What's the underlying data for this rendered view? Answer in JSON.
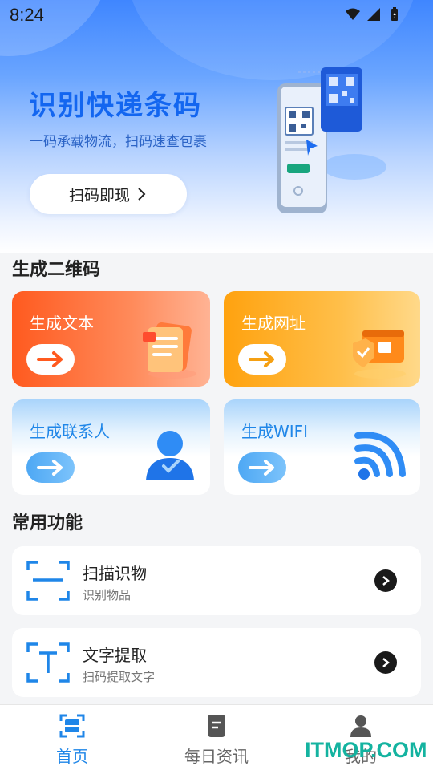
{
  "status_bar": {
    "time": "8:24"
  },
  "hero": {
    "title": "识别快递条码",
    "subtitle": "一码承载物流，扫码速查包裹",
    "scan_button": "扫码即现"
  },
  "generate_section": {
    "title": "生成二维码",
    "cards": [
      {
        "label": "生成文本",
        "icon": "document-icon"
      },
      {
        "label": "生成网址",
        "icon": "browser-icon"
      },
      {
        "label": "生成联系人",
        "icon": "person-icon"
      },
      {
        "label": "生成WIFI",
        "icon": "wifi-icon"
      }
    ]
  },
  "common_section": {
    "title": "常用功能",
    "items": [
      {
        "title": "扫描识物",
        "subtitle": "识别物品",
        "icon": "scan-frame-icon"
      },
      {
        "title": "文字提取",
        "subtitle": "扫码提取文字",
        "icon": "text-extract-icon"
      }
    ]
  },
  "bottom_nav": {
    "items": [
      {
        "label": "首页",
        "icon": "home-scan-icon",
        "active": true
      },
      {
        "label": "每日资讯",
        "icon": "news-icon",
        "active": false
      },
      {
        "label": "我的",
        "icon": "profile-icon",
        "active": false
      }
    ]
  },
  "watermark": "ITMOP.COM",
  "colors": {
    "accent_blue": "#1f86e8",
    "title_blue": "#1366f0",
    "card_orange": "#ff5a1f",
    "card_amber": "#ffa20f"
  }
}
